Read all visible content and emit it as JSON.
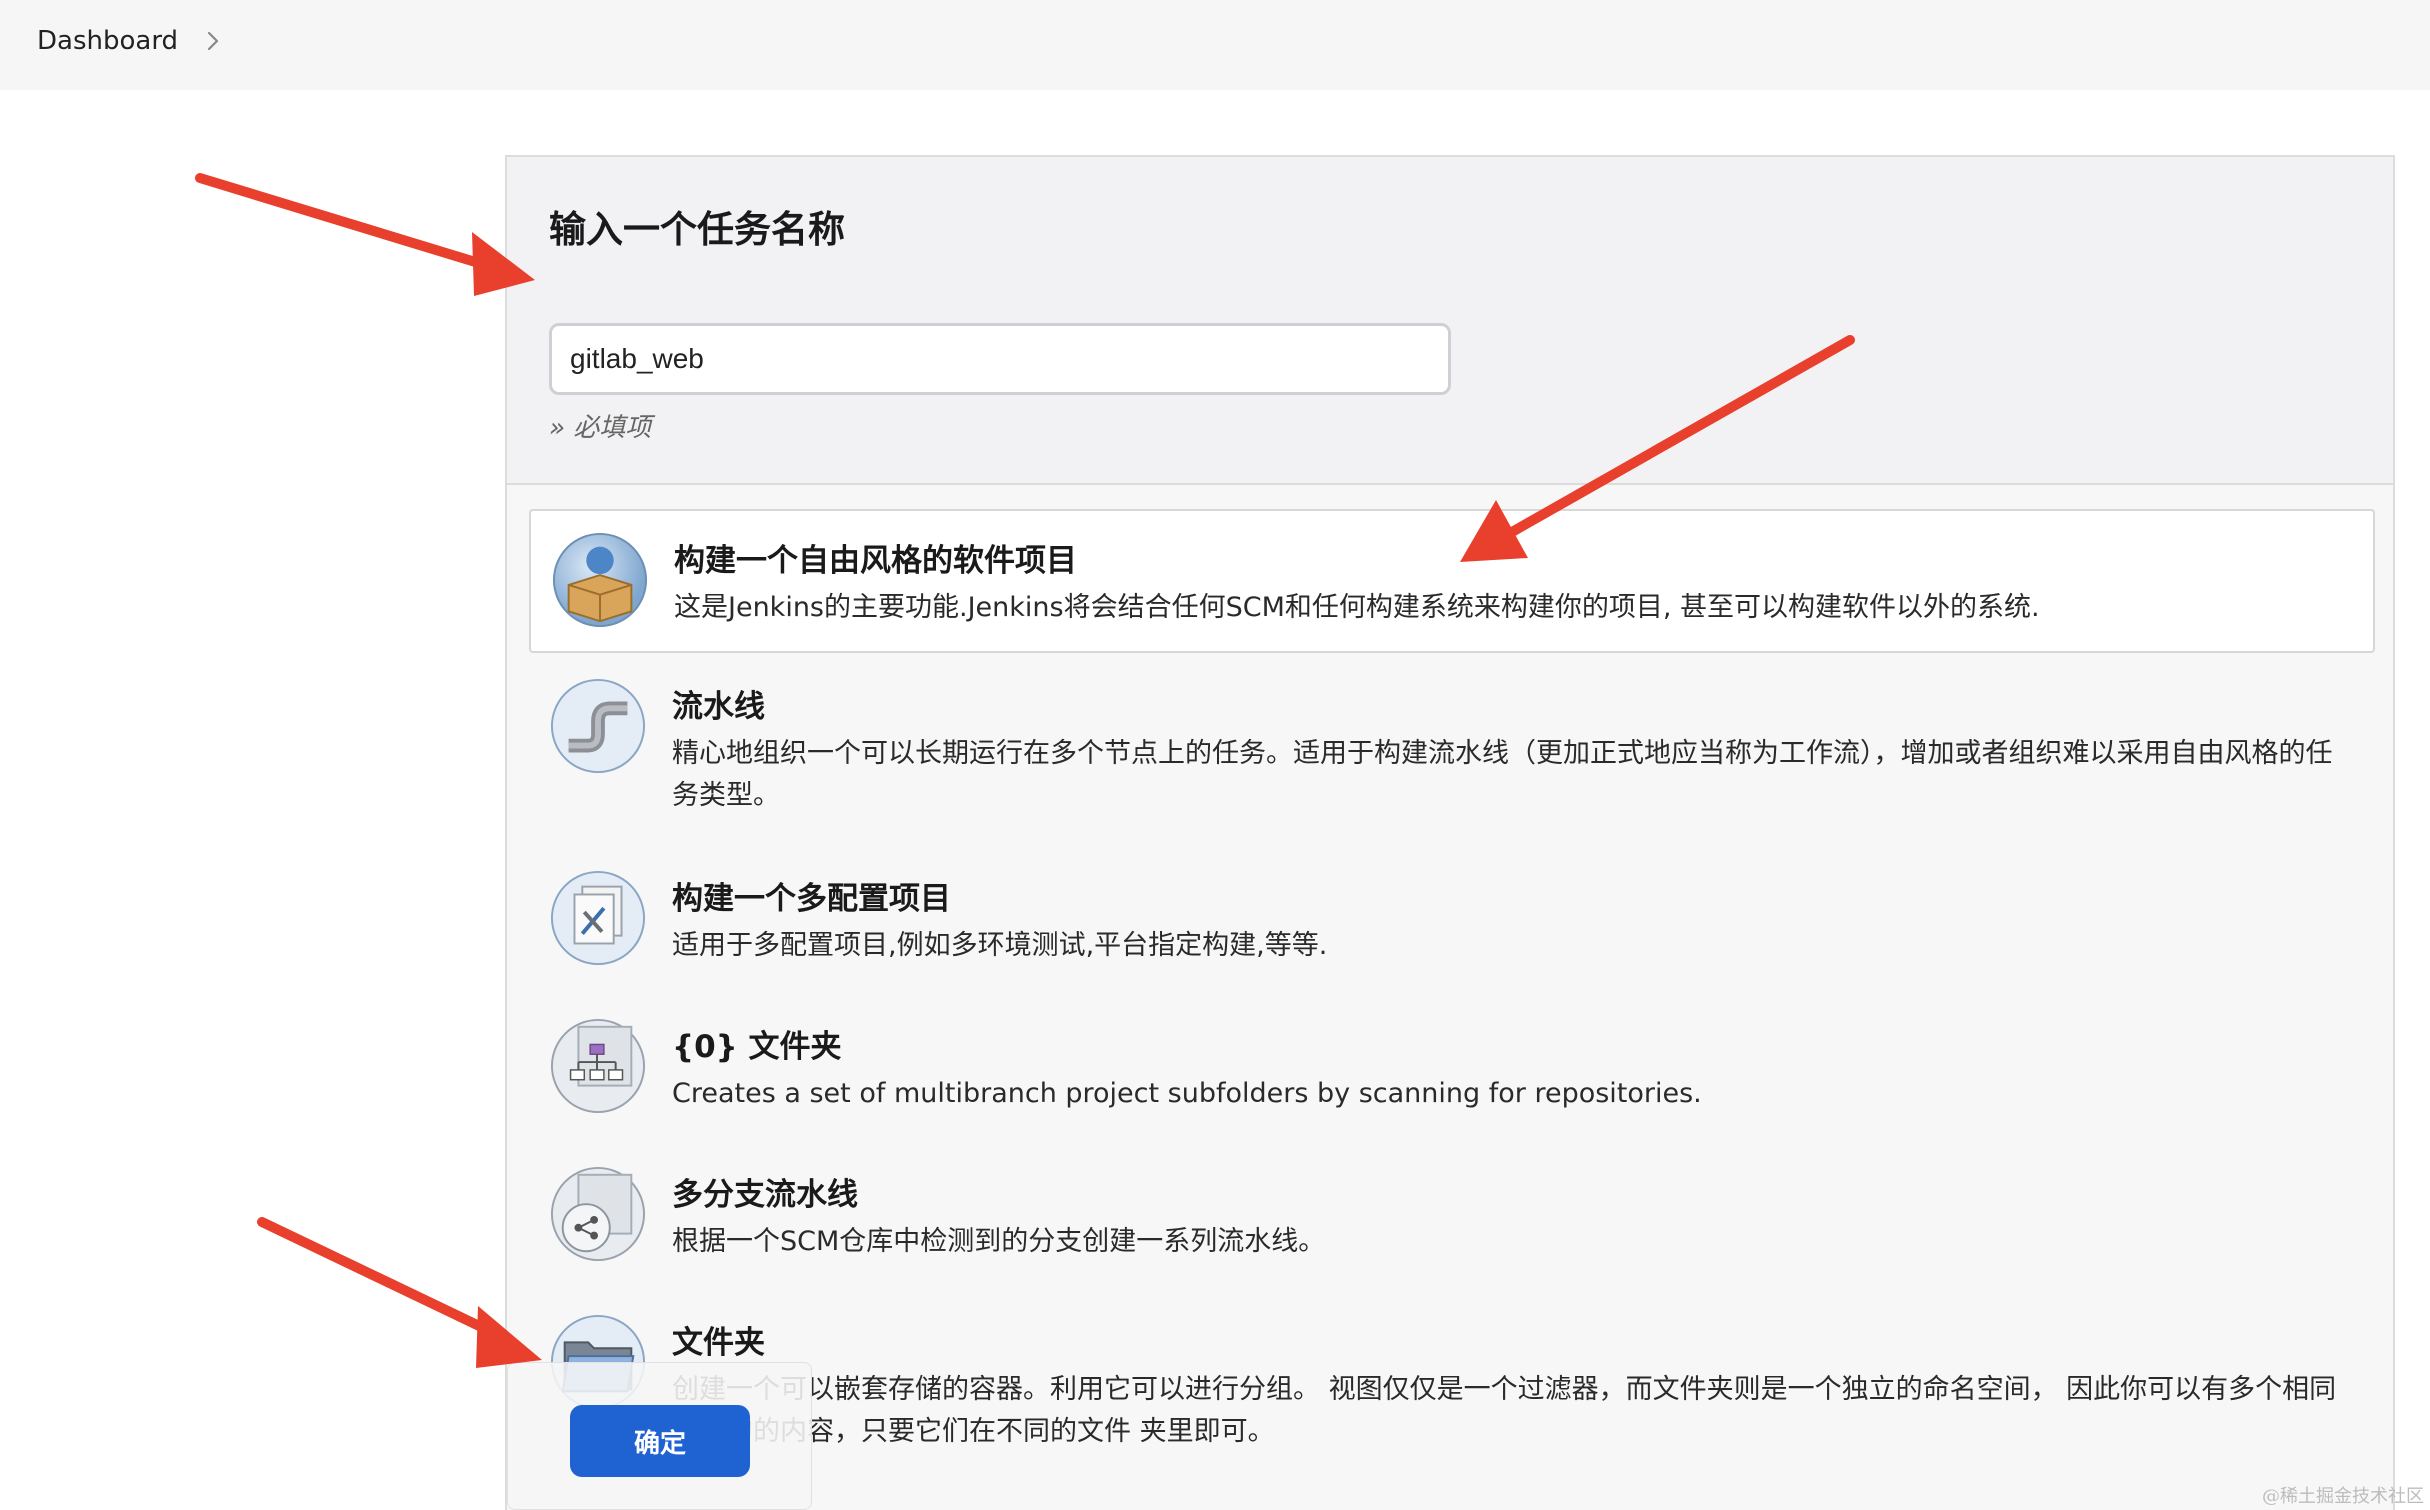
{
  "breadcrumb": {
    "home": "Dashboard"
  },
  "form": {
    "title": "输入一个任务名称",
    "job_name": "gitlab_web",
    "required_note": "» 必填项"
  },
  "job_types": [
    {
      "title": "构建一个自由风格的软件项目",
      "description": "这是Jenkins的主要功能.Jenkins将会结合任何SCM和任何构建系统来构建你的项目, 甚至可以构建软件以外的系统.",
      "icon": "freestyle-project-icon",
      "selected": true
    },
    {
      "title": "流水线",
      "description": "精心地组织一个可以长期运行在多个节点上的任务。适用于构建流水线（更加正式地应当称为工作流），增加或者组织难以采用自由风格的任务类型。",
      "icon": "pipeline-icon",
      "selected": false
    },
    {
      "title": "构建一个多配置项目",
      "description": "适用于多配置项目,例如多环境测试,平台指定构建,等等.",
      "icon": "multi-config-project-icon",
      "selected": false
    },
    {
      "title": "{0} 文件夹",
      "description": "Creates a set of multibranch project subfolders by scanning for repositories.",
      "icon": "organization-folder-icon",
      "selected": false
    },
    {
      "title": "多分支流水线",
      "description": "根据一个SCM仓库中检测到的分支创建一系列流水线。",
      "icon": "multibranch-pipeline-icon",
      "selected": false
    },
    {
      "title": "文件夹",
      "description": "创建一个可以嵌套存储的容器。利用它可以进行分组。 视图仅仅是一个过滤器，而文件夹则是一个独立的命名空间， 因此你可以有多个相同名称的的内容，只要它们在不同的文件 夹里即可。",
      "icon": "folder-icon",
      "selected": false
    }
  ],
  "actions": {
    "ok_label": "确定"
  },
  "watermark": "@稀土掘金技术社区",
  "colors": {
    "accent": "#1f62d1",
    "annotation_arrow": "#e8402c"
  }
}
